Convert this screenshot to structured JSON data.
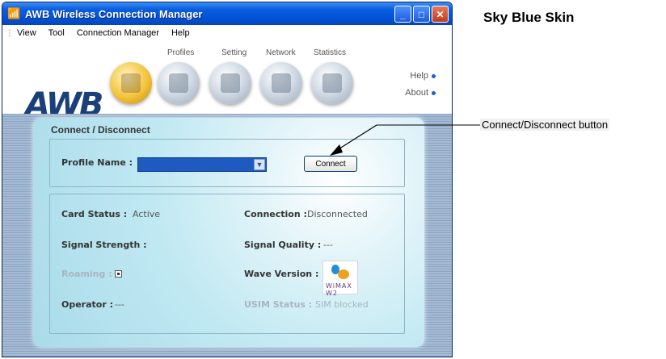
{
  "window": {
    "title": "AWB Wireless Connection Manager",
    "controls": {
      "minimize": "_",
      "maximize": "□",
      "close": "✕"
    }
  },
  "menu": [
    "View",
    "Tool",
    "Connection Manager",
    "Help"
  ],
  "toolbar": {
    "logo": "AWB",
    "tabs": [
      "Profiles",
      "Setting",
      "Network",
      "Statistics"
    ],
    "side_links": [
      "Help",
      "About"
    ]
  },
  "panel": {
    "title": "Connect / Disconnect",
    "profile_label": "Profile Name :",
    "profile_value": "",
    "connect_button": "Connect",
    "card_status_label": "Card Status :",
    "card_status_value": "Active",
    "connection_label": "Connection :",
    "connection_value": "Disconnected",
    "signal_strength_label": "Signal Strength :",
    "signal_quality_label": "Signal Quality :",
    "signal_quality_value": "---",
    "roaming_label": "Roaming :",
    "wave_version_label": "Wave Version :",
    "wimax_logo_text": "WiMAX W2",
    "operator_label": "Operator :",
    "operator_value": "---",
    "usim_status_label": "USIM Status :",
    "usim_status_value": "SIM blocked"
  },
  "annotations": {
    "skin_title": "Sky Blue Skin",
    "connect_button_callout": "Connect/Disconnect button"
  },
  "colors": {
    "titlebar": "#0052d6",
    "panel": "#bfe8f2",
    "profile_select": "#1f5ac0"
  }
}
